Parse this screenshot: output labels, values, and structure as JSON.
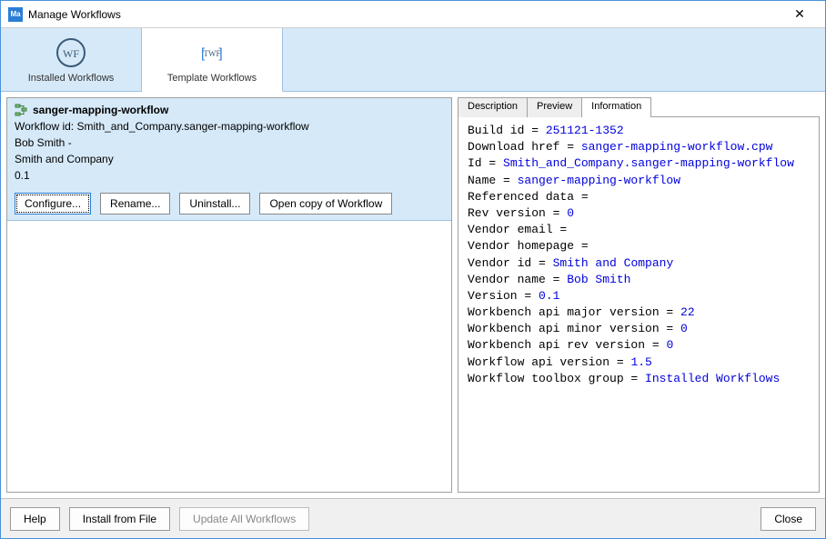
{
  "window": {
    "title": "Manage Workflows",
    "icon_text": "Ma"
  },
  "top_tabs": [
    {
      "label": "Installed Workflows",
      "icon": "WF"
    },
    {
      "label": "Template Workflows",
      "icon": "TWF"
    }
  ],
  "workflow": {
    "name": "sanger-mapping-workflow",
    "id_line": "Workflow id: Smith_and_Company.sanger-mapping-workflow",
    "author": "Bob Smith -",
    "company": "Smith and Company",
    "version": "0.1",
    "buttons": {
      "configure": "Configure...",
      "rename": "Rename...",
      "uninstall": "Uninstall...",
      "open_copy": "Open copy of Workflow"
    }
  },
  "info_tabs": [
    "Description",
    "Preview",
    "Information"
  ],
  "info_rows": [
    {
      "k": "Build id = ",
      "v": "251121-1352"
    },
    {
      "k": "Download href = ",
      "v": "sanger-mapping-workflow.cpw"
    },
    {
      "k": "Id = ",
      "v": "Smith_and_Company.sanger-mapping-workflow"
    },
    {
      "k": "Name = ",
      "v": "sanger-mapping-workflow"
    },
    {
      "k": "Referenced data =",
      "v": ""
    },
    {
      "k": "Rev version = ",
      "v": "0"
    },
    {
      "k": "Vendor email =",
      "v": ""
    },
    {
      "k": "Vendor homepage =",
      "v": ""
    },
    {
      "k": "Vendor id = ",
      "v": "Smith and Company"
    },
    {
      "k": "Vendor name = ",
      "v": "Bob Smith"
    },
    {
      "k": "Version = ",
      "v": "0.1"
    },
    {
      "k": "Workbench api major version = ",
      "v": "22"
    },
    {
      "k": "Workbench api minor version = ",
      "v": "0"
    },
    {
      "k": "Workbench api rev version = ",
      "v": "0"
    },
    {
      "k": "Workflow api version = ",
      "v": "1.5"
    },
    {
      "k": "Workflow toolbox group = ",
      "v": "Installed Workflows"
    }
  ],
  "footer": {
    "help": "Help",
    "install": "Install from File",
    "update": "Update All Workflows",
    "close": "Close"
  }
}
